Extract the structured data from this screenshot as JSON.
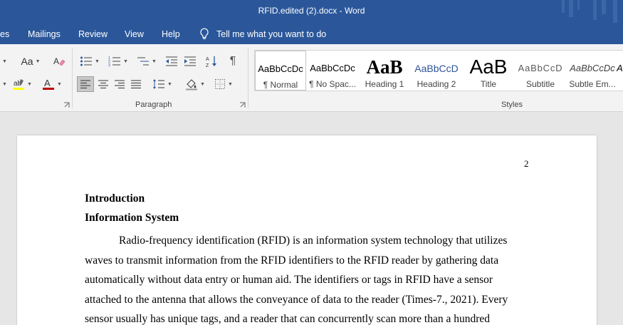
{
  "window": {
    "title": "RFID.edited (2).docx  -  Word"
  },
  "tabs": [
    {
      "label": "es"
    },
    {
      "label": "Mailings"
    },
    {
      "label": "Review"
    },
    {
      "label": "View"
    },
    {
      "label": "Help"
    }
  ],
  "tell_me": {
    "label": "Tell me what you want to do",
    "icon": "lightbulb-icon"
  },
  "ribbon": {
    "font_group": {
      "change_case_label": "Aa",
      "clear_format_icon": "eraser-icon",
      "highlight_icon": "highlighter-icon",
      "font_color_icon": "font-color-icon",
      "highlight_color": "#ffff00",
      "font_color": "#c00000"
    },
    "paragraph_group": {
      "label": "Paragraph",
      "bullets_icon": "bullets-icon",
      "numbering_icon": "numbering-icon",
      "multilevel_icon": "multilevel-list-icon",
      "decrease_indent_icon": "decrease-indent-icon",
      "increase_indent_icon": "increase-indent-icon",
      "sort_icon": "sort-icon",
      "pilcrow_label": "¶",
      "align_left_icon": "align-left-icon",
      "center_icon": "align-center-icon",
      "align_right_icon": "align-right-icon",
      "justify_icon": "justify-icon",
      "line_spacing_icon": "line-spacing-icon",
      "shading_icon": "shading-icon",
      "borders_icon": "borders-icon"
    },
    "styles_group": {
      "label": "Styles",
      "items": [
        {
          "preview": "AaBbCcDc",
          "name": "¶ Normal"
        },
        {
          "preview": "AaBbCcDc",
          "name": "¶ No Spac..."
        },
        {
          "preview": "AaB",
          "name": "Heading 1"
        },
        {
          "preview": "AaBbCcD",
          "name": "Heading 2"
        },
        {
          "preview": "AaB",
          "name": "Title"
        },
        {
          "preview": "AaBbCcD",
          "name": "Subtitle"
        },
        {
          "preview": "AaBbCcDc",
          "name": "Subtle Em..."
        },
        {
          "preview": "A",
          "name": ""
        }
      ]
    }
  },
  "document": {
    "page_number": "2",
    "heading1": "Introduction",
    "heading2": "Information System",
    "lines": [
      "Radio-frequency identification (RFID) is an information system technology that utilizes",
      "waves to transmit information from the RFID identifiers to the RFID reader by gathering data",
      "automatically without data entry or human aid. The identifiers or tags in RFID have a sensor",
      "attached to the antenna that allows the conveyance of data to the reader (Times-7., 2021).  Every",
      "sensor usually has unique tags, and a reader that can concurrently scan more than a hundred"
    ]
  },
  "colors": {
    "brand": "#2b579a",
    "ribbon_bg": "#f3f3f3",
    "doc_bg": "#e6e6e6",
    "heading2_style": "#2f5496"
  }
}
